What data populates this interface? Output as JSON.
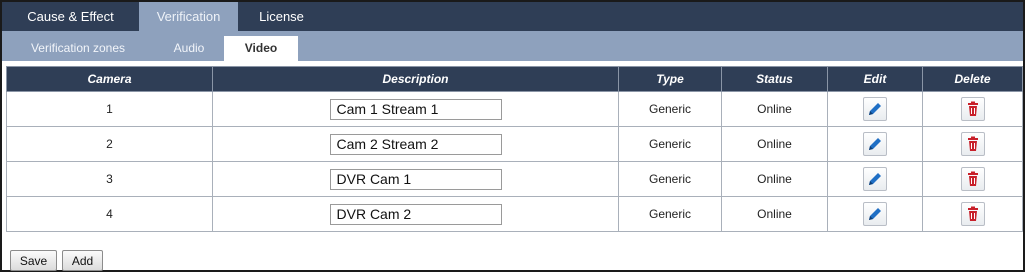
{
  "top_tabs": [
    {
      "label": "Cause & Effect",
      "active": false
    },
    {
      "label": "Verification",
      "active": true
    },
    {
      "label": "License",
      "active": false
    }
  ],
  "sub_tabs": [
    {
      "label": "Verification zones",
      "active": false
    },
    {
      "label": "Audio",
      "active": false
    },
    {
      "label": "Video",
      "active": true
    }
  ],
  "table": {
    "columns": [
      "Camera",
      "Description",
      "Type",
      "Status",
      "Edit",
      "Delete"
    ],
    "rows": [
      {
        "camera": "1",
        "description": "Cam 1 Stream 1",
        "type": "Generic",
        "status": "Online"
      },
      {
        "camera": "2",
        "description": "Cam 2 Stream 2",
        "type": "Generic",
        "status": "Online"
      },
      {
        "camera": "3",
        "description": "DVR Cam 1",
        "type": "Generic",
        "status": "Online"
      },
      {
        "camera": "4",
        "description": "DVR Cam 2",
        "type": "Generic",
        "status": "Online"
      }
    ]
  },
  "actions": {
    "save_label": "Save",
    "add_label": "Add"
  },
  "icons": {
    "edit": "pencil-icon",
    "delete": "trash-icon"
  },
  "colors": {
    "header_bg": "#2f3e56",
    "active_tab_bg": "#8ea1bd",
    "pencil": "#1f6fc5",
    "trash": "#c8202a"
  }
}
